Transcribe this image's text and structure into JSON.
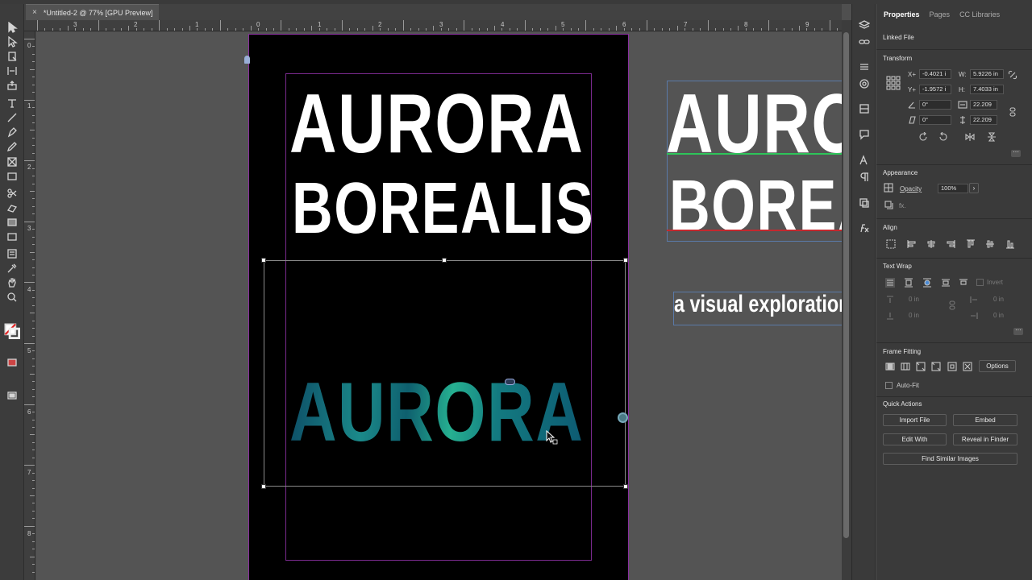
{
  "document": {
    "tab_close": "×",
    "tab_title": "*Untitled-2 @ 77% [GPU Preview]"
  },
  "rulers": {
    "h_labels": [
      "3",
      "2",
      "1",
      "0",
      "1",
      "2",
      "3",
      "4",
      "5",
      "6",
      "7",
      "8",
      "9"
    ],
    "v_labels": [
      "0",
      "1",
      "2",
      "3",
      "4",
      "5",
      "6",
      "7",
      "8"
    ]
  },
  "canvas": {
    "headline_1": "AURORA",
    "headline_2": "BOREALIS",
    "image_text": "AURORA",
    "pasteboard_headline_1": "AURORA",
    "pasteboard_headline_2": "BOREALIS",
    "pasteboard_subtitle": "a visual exploration"
  },
  "panel": {
    "tabs": [
      "Properties",
      "Pages",
      "CC Libraries"
    ],
    "linked_file": "Linked File",
    "transform": {
      "title": "Transform",
      "x_label": "X+",
      "x_value": "-0.4021 i",
      "y_label": "Y+",
      "y_value": "-1.9572 i",
      "w_label": "W:",
      "w_value": "5.9226 in",
      "h_label": "H:",
      "h_value": "7.4033 in",
      "rotate_value": "0°",
      "shear_value": "0°",
      "scale_x_value": "22.209",
      "scale_y_value": "22.209"
    },
    "appearance": {
      "title": "Appearance",
      "opacity_label": "Opacity",
      "opacity_value": "100%",
      "fx_label": "fx."
    },
    "align": {
      "title": "Align"
    },
    "text_wrap": {
      "title": "Text Wrap",
      "invert_label": "Invert",
      "offset_top": "0 in",
      "offset_bottom": "0 in",
      "offset_left": "0 in",
      "offset_right": "0 in"
    },
    "frame_fitting": {
      "title": "Frame Fitting",
      "options_button": "Options",
      "autofit_label": "Auto-Fit"
    },
    "quick_actions": {
      "title": "Quick Actions",
      "import_file": "Import File",
      "embed": "Embed",
      "edit_with": "Edit With",
      "reveal_in_finder": "Reveal in Finder",
      "find_similar": "Find Similar Images"
    }
  },
  "colors": {
    "app_bg": "#535353",
    "page_bg": "#000000",
    "margin_guide": "#7a2a8e",
    "aurora_teal": "#1b8a8a",
    "aurora_green": "#26b091"
  },
  "icons": [
    "selection-tool-icon",
    "direct-selection-icon",
    "page-tool-icon",
    "gap-tool-icon",
    "content-collector-icon",
    "type-tool-icon",
    "line-tool-icon",
    "pen-tool-icon",
    "pencil-tool-icon",
    "rectangle-frame-icon",
    "rectangle-icon",
    "scissors-icon",
    "free-transform-icon",
    "gradient-swatch-icon",
    "gradient-feather-icon",
    "note-icon",
    "eyedropper-icon",
    "hand-icon",
    "zoom-icon",
    "fill-stroke-icon",
    "screen-mode-icon"
  ]
}
